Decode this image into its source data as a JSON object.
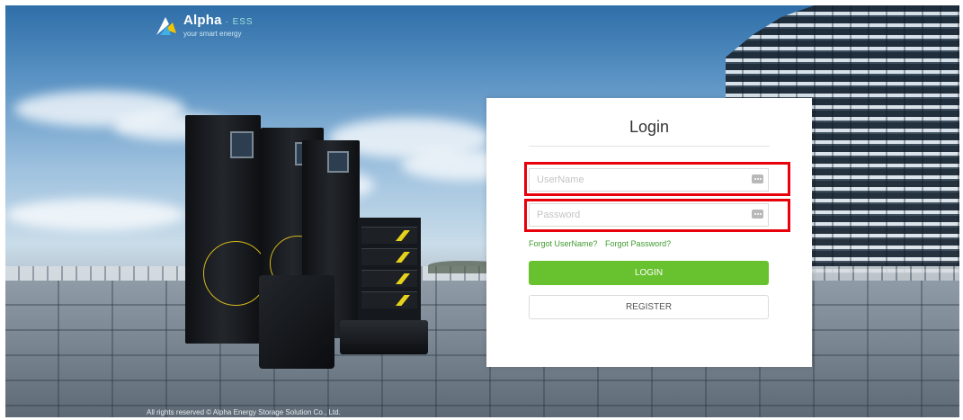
{
  "brand": {
    "name": "Alpha",
    "suffix": "ESS",
    "tagline": "your smart energy"
  },
  "login": {
    "title": "Login",
    "username_placeholder": "UserName",
    "password_placeholder": "Password",
    "forgot_username": "Forgot UserName?",
    "forgot_password": "Forgot Password?",
    "login_button": "LOGIN",
    "register_button": "REGISTER"
  },
  "footer": {
    "copyright": "All rights reserved © Alpha Energy Storage Solution Co., Ltd."
  },
  "colors": {
    "accent_green": "#68c12f",
    "link_green": "#3e9b2f",
    "highlight_red": "#e8000c"
  }
}
